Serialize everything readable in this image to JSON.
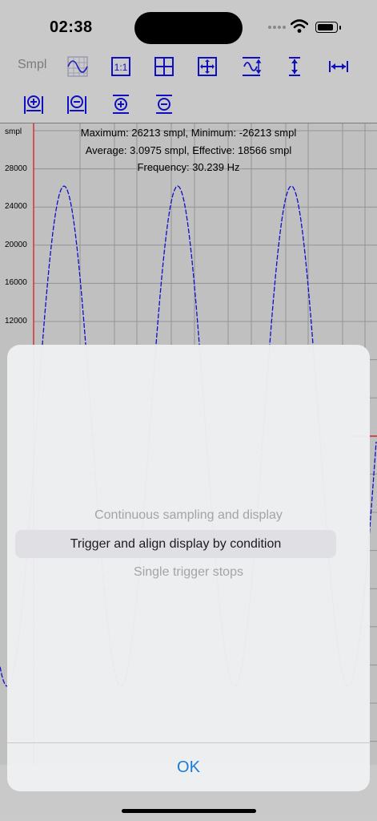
{
  "status_bar": {
    "time": "02:38"
  },
  "toolbar": {
    "unit_label": "Smpl",
    "row1": [
      "waveform-grid-icon",
      "one-to-one-icon",
      "grid-icon",
      "move-icon",
      "auto-scale-icon",
      "vertical-fit-icon",
      "horizontal-fit-icon"
    ],
    "row2": [
      "h-zoom-in-icon",
      "h-zoom-out-icon",
      "v-zoom-in-icon",
      "v-zoom-out-icon"
    ]
  },
  "chart_data": {
    "type": "line",
    "y_unit": "smpl",
    "yticks": [
      "28000",
      "24000",
      "20000",
      "16000",
      "12000"
    ],
    "stats": {
      "line1": "Maximum: 26213 smpl, Minimum: -26213 smpl",
      "line2": "Average: 3.0975 smpl, Effective: 18566 smpl",
      "line3": "Frequency: 30.239 Hz"
    },
    "series": [
      {
        "color": "#1010d0",
        "amplitude": 26213
      }
    ],
    "grid": true,
    "trigger_line_color": "#e01010"
  },
  "sheet": {
    "options": [
      "Continuous sampling and display",
      "Trigger and align display by condition",
      "Single trigger stops"
    ],
    "selected_index": 1,
    "ok_label": "OK"
  }
}
